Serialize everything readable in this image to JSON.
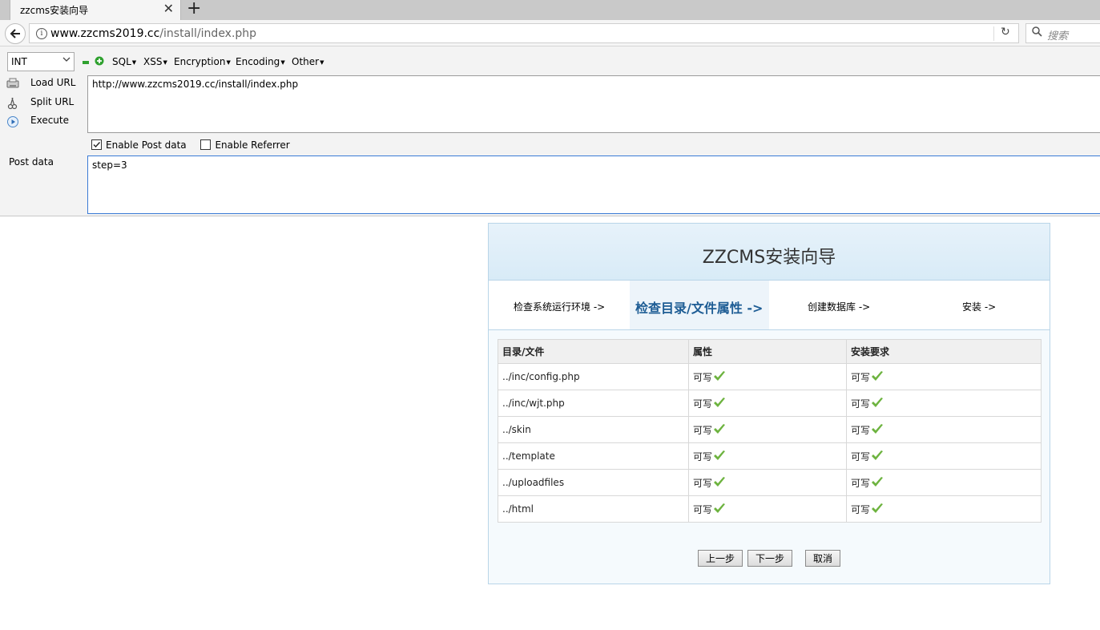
{
  "browser": {
    "tab_title": "zzcms安装向导",
    "close_symbol": "✕",
    "new_tab_symbol": "+",
    "url_host": "www.zzcms2019.cc",
    "url_path": "/install/index.php",
    "search_placeholder": "搜索"
  },
  "hackbar": {
    "int_value": "INT",
    "menus": [
      "SQL",
      "XSS",
      "Encryption",
      "Encoding",
      "Other"
    ],
    "actions": {
      "load_url": "Load URL",
      "split_url": "Split URL",
      "execute": "Execute"
    },
    "url_value": "http://www.zzcms2019.cc/install/index.php",
    "enable_post_label": "Enable Post data",
    "enable_post_checked": true,
    "enable_referrer_label": "Enable Referrer",
    "enable_referrer_checked": false,
    "post_label": "Post data",
    "post_value": "step=3"
  },
  "installer": {
    "title": "ZZCMS安装向导",
    "steps": [
      "检查系统运行环境 ->",
      "检查目录/文件属性 ->",
      "创建数据库 ->",
      "安装 ->"
    ],
    "active_step": 1,
    "table": {
      "headers": [
        "目录/文件",
        "属性",
        "安装要求"
      ],
      "rows": [
        [
          "../inc/config.php",
          "可写",
          "可写"
        ],
        [
          "../inc/wjt.php",
          "可写",
          "可写"
        ],
        [
          "../skin",
          "可写",
          "可写"
        ],
        [
          "../template",
          "可写",
          "可写"
        ],
        [
          "../uploadfiles",
          "可写",
          "可写"
        ],
        [
          "../html",
          "可写",
          "可写"
        ]
      ]
    },
    "buttons": {
      "prev": "上一步",
      "next": "下一步",
      "cancel": "取消"
    },
    "colors": {
      "accent": "#1d5c94",
      "check": "#6db33f"
    }
  }
}
